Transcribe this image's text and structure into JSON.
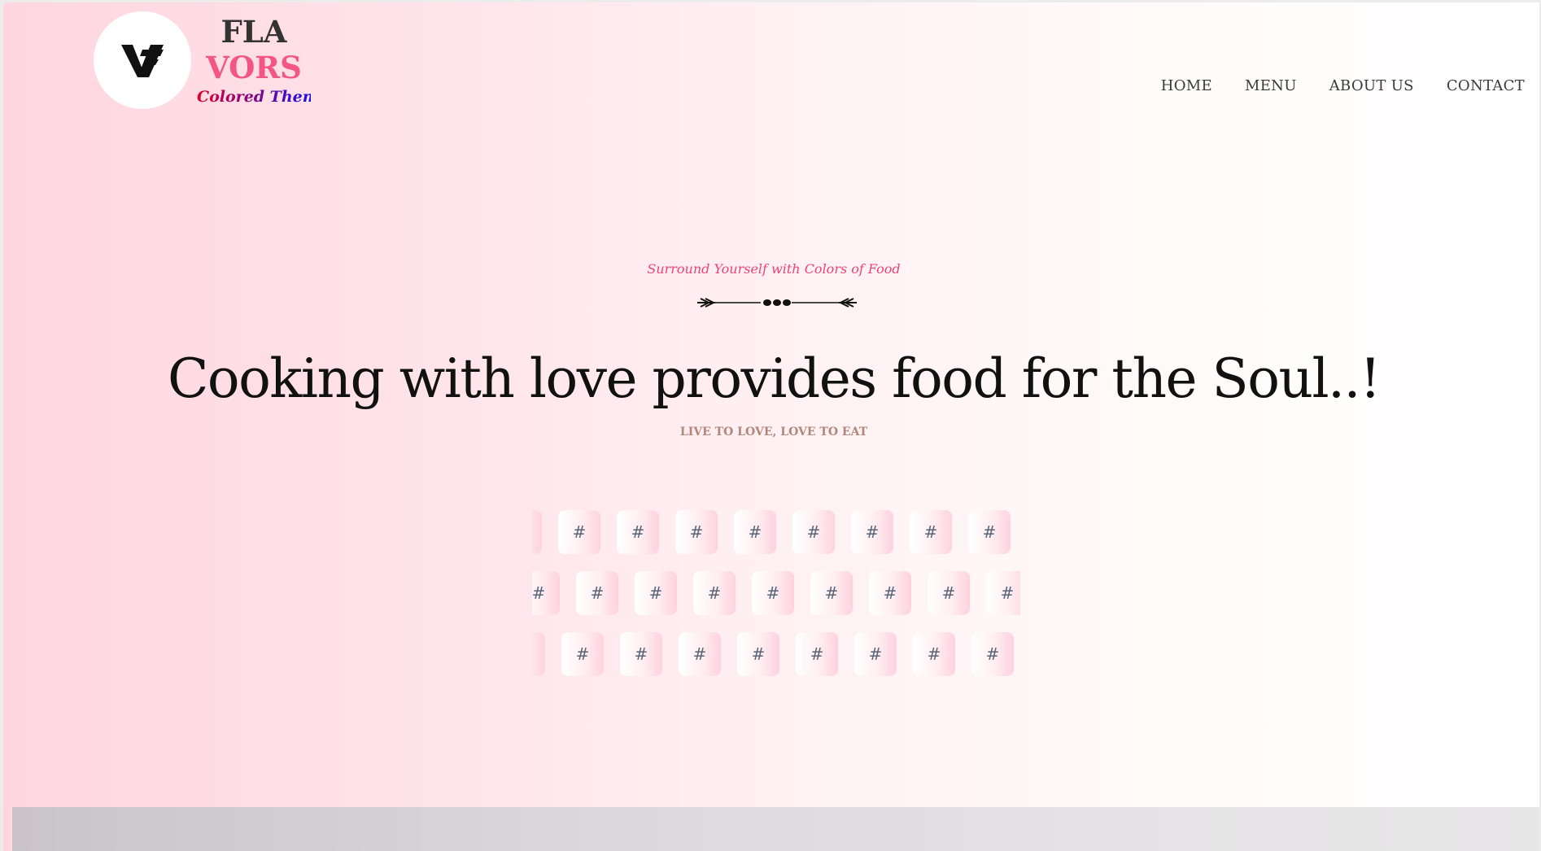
{
  "header": {
    "logo_icon": "vf-monogram-icon",
    "brand_line1": "FLA",
    "brand_line2": "VORS",
    "brand_tagline": "Colored Theme"
  },
  "nav": {
    "items": [
      {
        "label": "HOME"
      },
      {
        "label": "MENU"
      },
      {
        "label": "ABOUT US"
      },
      {
        "label": "CONTACT"
      }
    ]
  },
  "hero": {
    "tagline": "Surround Yourself with Colors of Food",
    "divider_icon": "ornamental-divider-icon",
    "headline": "Cooking with love provides food for the Soul..!",
    "subline": "LIVE TO LOVE, LOVE TO EAT"
  },
  "tags": {
    "symbol": "#",
    "rows": [
      {
        "count": 9
      },
      {
        "count": 9
      },
      {
        "count": 9
      }
    ]
  },
  "colors": {
    "accent_pink": "#f35585",
    "tagline_pink": "#e8457a",
    "subline_brown": "#b3867a",
    "tag_text": "#5a6478"
  }
}
